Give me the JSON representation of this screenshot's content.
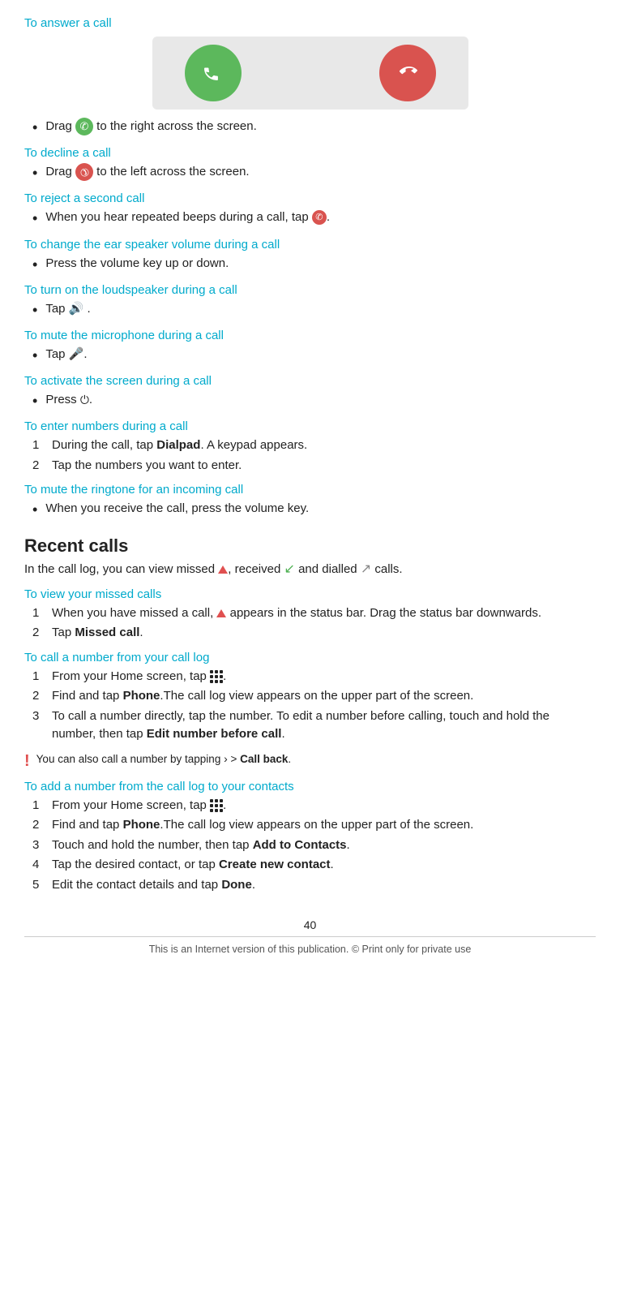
{
  "page": {
    "number": "40",
    "footer_legal": "This is an Internet version of this publication. © Print only for private use"
  },
  "sections": {
    "answer_call": {
      "heading": "To answer a call",
      "bullet": "Drag",
      "bullet_text": " to the right across the screen."
    },
    "decline_call": {
      "heading": "To decline a call",
      "bullet_text": "Drag  to the left across the screen."
    },
    "reject_second": {
      "heading": "To reject a second call",
      "bullet_text": "When you hear repeated beeps during a call, tap"
    },
    "ear_speaker": {
      "heading": "To change the ear speaker volume during a call",
      "bullet_text": "Press the volume key up or down."
    },
    "loudspeaker": {
      "heading": "To turn on the loudspeaker during a call",
      "bullet_text": "Tap"
    },
    "mute_mic": {
      "heading": "To mute the microphone during a call",
      "bullet_text": "Tap"
    },
    "activate_screen": {
      "heading": "To activate the screen during a call",
      "bullet_text": "Press"
    },
    "enter_numbers": {
      "heading": "To enter numbers during a call",
      "step1": "During the call, tap",
      "step1_bold": "Dialpad",
      "step1_rest": ". A keypad appears.",
      "step2": "Tap the numbers you want to enter."
    },
    "mute_ringtone": {
      "heading": "To mute the ringtone for an incoming call",
      "bullet_text": "When you receive the call, press the volume key."
    },
    "recent_calls": {
      "heading": "Recent calls",
      "description": "In the call log, you can view missed",
      "desc_received": ", received",
      "desc_dialled": "and dialled",
      "desc_end": "calls."
    },
    "view_missed": {
      "heading": "To view your missed calls",
      "step1": "When you have missed a call,",
      "step1_rest": " appears in the status bar. Drag the status bar downwards.",
      "step2": "Tap",
      "step2_bold": "Missed call",
      "step2_end": "."
    },
    "call_log": {
      "heading": "To call a number from your call log",
      "step1": "From your Home screen, tap",
      "step1_end": ".",
      "step2": "Find and tap",
      "step2_bold": "Phone",
      "step2_rest": ".The call log view appears on the upper part of the screen.",
      "step3": "To call a number directly, tap the number. To edit a number before calling, touch and hold the number, then tap",
      "step3_bold": "Edit number before call",
      "step3_end": ".",
      "note_text": "You can also call a number by tapping",
      "note_bold": " > Call back",
      "note_end": "."
    },
    "add_number": {
      "heading": "To add a number from the call log to your contacts",
      "step1": "From your Home screen, tap",
      "step1_end": ".",
      "step2": "Find and tap",
      "step2_bold": "Phone",
      "step2_rest": ".The call log view appears on the upper part of the screen.",
      "step3": "Touch and hold the number, then tap",
      "step3_bold": "Add to Contacts",
      "step3_end": ".",
      "step4": "Tap the desired contact, or tap",
      "step4_bold": "Create new contact",
      "step4_end": ".",
      "step5": "Edit the contact details and tap",
      "step5_bold": "Done",
      "step5_end": "."
    }
  }
}
